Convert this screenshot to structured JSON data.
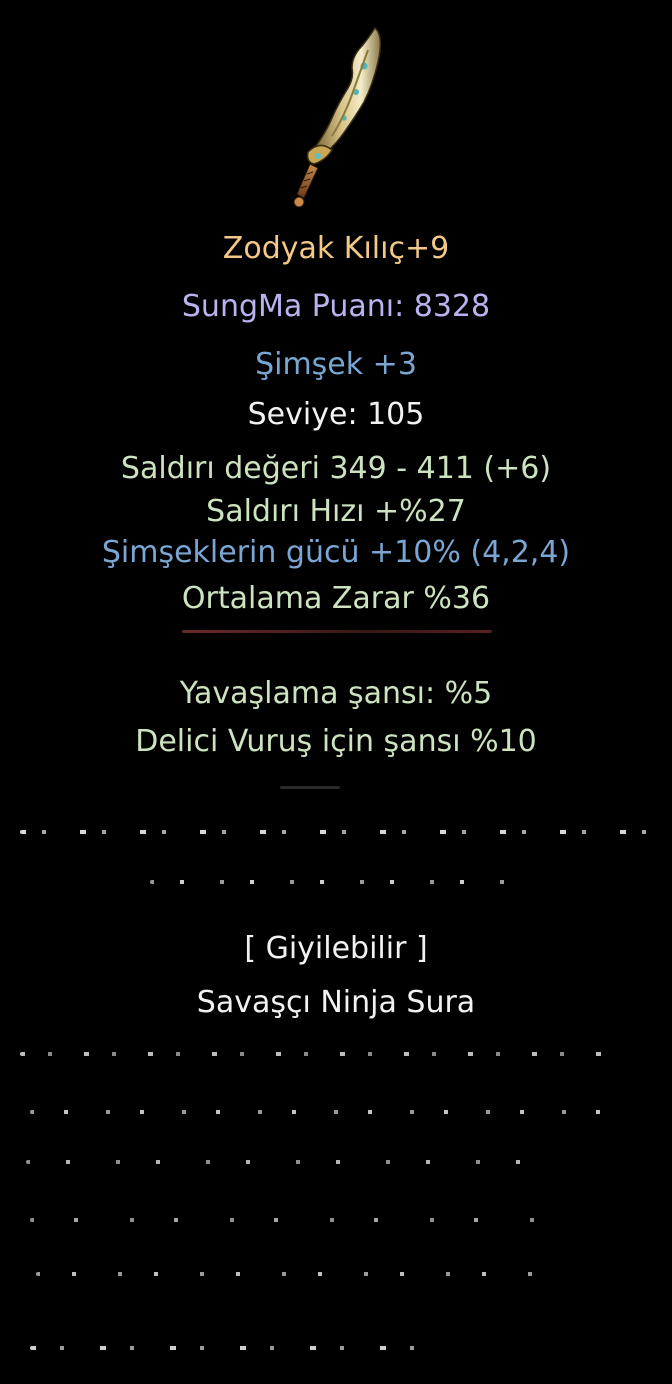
{
  "item": {
    "name": "Zodyak Kılıç+9",
    "sungma": "SungMa Puanı: 8328",
    "element": "Şimşek +3",
    "level": "Seviye: 105"
  },
  "stats": [
    "Saldırı değeri 349 - 411 (+6)",
    "Saldırı Hızı +%27",
    "Şimşeklerin gücü +10% (4,2,4)",
    "Ortalama Zarar %36",
    "Yavaşlama şansı: %5",
    "Delici Vuruş için şansı %10"
  ],
  "wearable": "[ Giyilebilir ]",
  "classes": "Savaşçı Ninja Sura",
  "colors": {
    "background": "#000000",
    "item_name": "#f3c888",
    "sungma": "#b9b4f0",
    "element": "#7aa6d4",
    "level": "#f2f2f2",
    "stat_green": "#cde3c0",
    "stat_blue": "#7aa6d4",
    "neutral": "#f2f2f2"
  },
  "icons": {
    "item": "curved-golden-sword-icon"
  }
}
